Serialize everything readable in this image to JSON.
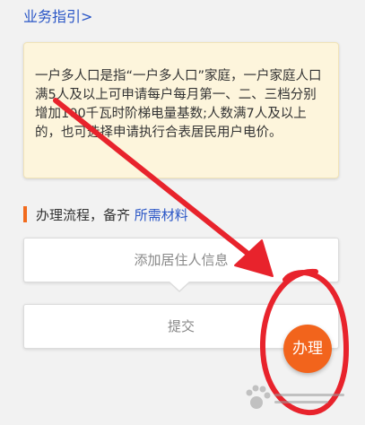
{
  "header": {
    "guide_link": "业务指引>"
  },
  "notice": {
    "text": "一户多人口是指“一户多人口”家庭，一户家庭人口满5人及以上可申请每户每月第一、二、三档分别增加100千瓦时阶梯电量基数;人数满7人及以上的，也可选择申请执行合表居民用户电价。"
  },
  "process": {
    "title": "办理流程，备齐",
    "materials_link": "所需材料"
  },
  "buttons": {
    "add_resident": "添加居住人信息",
    "submit": "提交"
  },
  "fab": {
    "label": "办理"
  },
  "colors": {
    "accent_orange": "#f2641c",
    "link_blue": "#2a56c6",
    "annotation_red": "#e8232c",
    "notice_bg": "#fdf5dc"
  }
}
